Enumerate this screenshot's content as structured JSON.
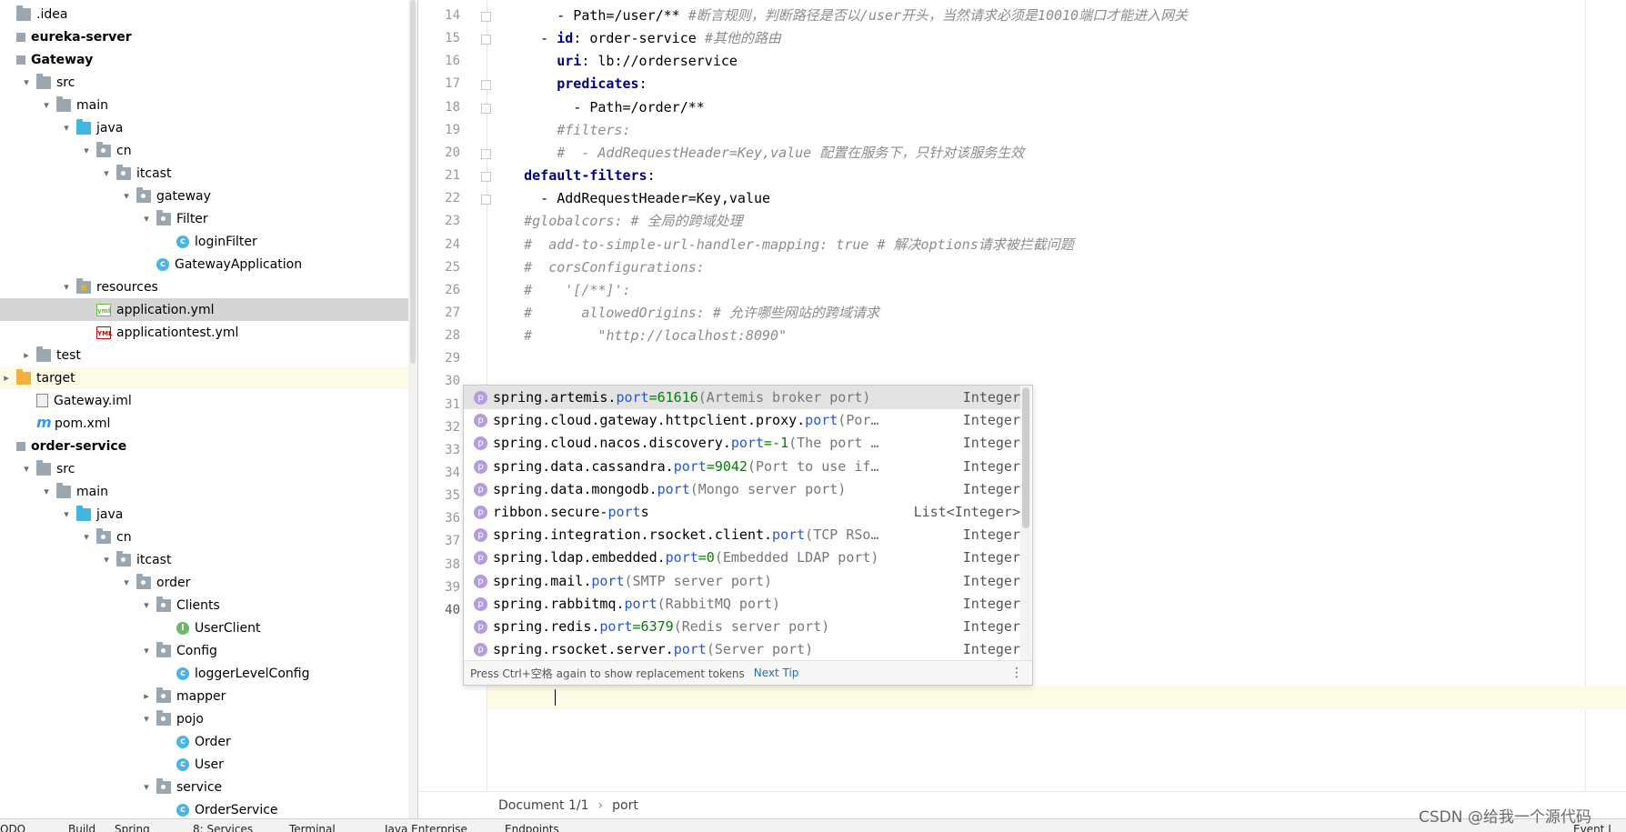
{
  "project_tree": {
    "items": [
      {
        "label": ".idea",
        "icon": "folder-icon",
        "arrow": "",
        "bold": false
      },
      {
        "label": "eureka-server",
        "icon": "module-icon",
        "arrow": "",
        "bold": true
      },
      {
        "label": "Gateway",
        "icon": "module-icon",
        "arrow": "",
        "bold": true
      },
      {
        "label": "src",
        "icon": "folder-icon",
        "arrow": "▾",
        "bold": false
      },
      {
        "label": "main",
        "icon": "folder-icon",
        "arrow": "▾",
        "bold": false
      },
      {
        "label": "java",
        "icon": "source-folder-icon",
        "arrow": "▾",
        "bold": false
      },
      {
        "label": "cn",
        "icon": "package-icon",
        "arrow": "▾",
        "bold": false
      },
      {
        "label": "itcast",
        "icon": "package-icon",
        "arrow": "▾",
        "bold": false
      },
      {
        "label": "gateway",
        "icon": "package-icon",
        "arrow": "▾",
        "bold": false
      },
      {
        "label": "Filter",
        "icon": "package-icon",
        "arrow": "▾",
        "bold": false
      },
      {
        "label": "loginFilter",
        "icon": "class-icon",
        "arrow": "",
        "bold": false
      },
      {
        "label": "GatewayApplication",
        "icon": "spring-boot-class-icon",
        "arrow": "",
        "bold": false
      },
      {
        "label": "resources",
        "icon": "resources-folder-icon",
        "arrow": "▾",
        "bold": false
      },
      {
        "label": "application.yml",
        "icon": "spring-yml-icon",
        "arrow": "",
        "bold": false
      },
      {
        "label": "applicationtest.yml",
        "icon": "yml-icon",
        "arrow": "",
        "bold": false
      },
      {
        "label": "test",
        "icon": "folder-icon",
        "arrow": "▸",
        "bold": false
      },
      {
        "label": "target",
        "icon": "excluded-folder-icon",
        "arrow": "▸",
        "bold": false
      },
      {
        "label": "Gateway.iml",
        "icon": "iml-file-icon",
        "arrow": "",
        "bold": false
      },
      {
        "label": "pom.xml",
        "icon": "maven-icon",
        "arrow": "",
        "bold": false
      },
      {
        "label": "order-service",
        "icon": "module-icon",
        "arrow": "",
        "bold": true
      },
      {
        "label": "src",
        "icon": "folder-icon",
        "arrow": "▾",
        "bold": false
      },
      {
        "label": "main",
        "icon": "folder-icon",
        "arrow": "▾",
        "bold": false
      },
      {
        "label": "java",
        "icon": "source-folder-icon",
        "arrow": "▾",
        "bold": false
      },
      {
        "label": "cn",
        "icon": "package-icon",
        "arrow": "▾",
        "bold": false
      },
      {
        "label": "itcast",
        "icon": "package-icon",
        "arrow": "▾",
        "bold": false
      },
      {
        "label": "order",
        "icon": "package-icon",
        "arrow": "▾",
        "bold": false
      },
      {
        "label": "Clients",
        "icon": "package-icon",
        "arrow": "▾",
        "bold": false
      },
      {
        "label": "UserClient",
        "icon": "interface-icon",
        "arrow": "",
        "bold": false
      },
      {
        "label": "Config",
        "icon": "package-icon",
        "arrow": "▾",
        "bold": false
      },
      {
        "label": "loggerLevelConfig",
        "icon": "class-icon",
        "arrow": "",
        "bold": false
      },
      {
        "label": "mapper",
        "icon": "package-icon",
        "arrow": "▸",
        "bold": false
      },
      {
        "label": "pojo",
        "icon": "package-icon",
        "arrow": "▾",
        "bold": false
      },
      {
        "label": "Order",
        "icon": "class-icon",
        "arrow": "",
        "bold": false
      },
      {
        "label": "User",
        "icon": "class-icon",
        "arrow": "",
        "bold": false
      },
      {
        "label": "service",
        "icon": "package-icon",
        "arrow": "▾",
        "bold": false
      },
      {
        "label": "OrderService",
        "icon": "class-icon",
        "arrow": "",
        "bold": false
      }
    ],
    "selected_label": "application.yml"
  },
  "editor": {
    "lines": [
      {
        "n": "14",
        "segments": [
          [
            "",
            "        - Path=/user/** "
          ],
          [
            "cm",
            "#断言规则，判断路径是否以/user开头，当然请求必须是10010端口才能进入网关"
          ]
        ]
      },
      {
        "n": "15",
        "segments": [
          [
            "",
            "      - "
          ],
          [
            "kw",
            "id"
          ],
          [
            "",
            ": order-service "
          ],
          [
            "cm",
            "#其他的路由"
          ]
        ]
      },
      {
        "n": "16",
        "segments": [
          [
            "",
            "        "
          ],
          [
            "kw",
            "uri"
          ],
          [
            "",
            ": lb://orderservice"
          ]
        ]
      },
      {
        "n": "17",
        "segments": [
          [
            "",
            "        "
          ],
          [
            "kw",
            "predicates"
          ],
          [
            "",
            ":"
          ]
        ]
      },
      {
        "n": "18",
        "segments": [
          [
            "",
            "          - Path=/order/**"
          ]
        ]
      },
      {
        "n": "19",
        "segments": [
          [
            "",
            "        "
          ],
          [
            "cm",
            "#filters:"
          ]
        ]
      },
      {
        "n": "20",
        "segments": [
          [
            "",
            "        "
          ],
          [
            "cm",
            "#  - AddRequestHeader=Key,value 配置在服务下，只针对该服务生效"
          ]
        ]
      },
      {
        "n": "21",
        "segments": [
          [
            "",
            "    "
          ],
          [
            "kw",
            "default-filters"
          ],
          [
            "",
            ":"
          ]
        ]
      },
      {
        "n": "22",
        "segments": [
          [
            "",
            "      - AddRequestHeader=Key,value"
          ]
        ]
      },
      {
        "n": "23",
        "segments": [
          [
            "",
            "    "
          ],
          [
            "cm",
            "#globalcors: # 全局的跨域处理"
          ]
        ]
      },
      {
        "n": "24",
        "segments": [
          [
            "",
            "    "
          ],
          [
            "cm",
            "#  add-to-simple-url-handler-mapping: true # 解决options请求被拦截问题"
          ]
        ]
      },
      {
        "n": "25",
        "segments": [
          [
            "",
            "    "
          ],
          [
            "cm",
            "#  corsConfigurations:"
          ]
        ]
      },
      {
        "n": "26",
        "segments": [
          [
            "",
            "    "
          ],
          [
            "cm",
            "#    '[/**]':"
          ]
        ]
      },
      {
        "n": "27",
        "segments": [
          [
            "",
            "    "
          ],
          [
            "cm",
            "#      allowedOrigins: # 允许哪些网站的跨域请求"
          ]
        ]
      },
      {
        "n": "28",
        "segments": [
          [
            "",
            "    "
          ],
          [
            "cm",
            "#        \"http://localhost:8090\""
          ]
        ]
      },
      {
        "n": "29",
        "segments": []
      },
      {
        "n": "30",
        "segments": []
      },
      {
        "n": "31",
        "segments": []
      },
      {
        "n": "32",
        "segments": []
      },
      {
        "n": "33",
        "segments": []
      },
      {
        "n": "34",
        "segments": []
      },
      {
        "n": "35",
        "segments": []
      },
      {
        "n": "36",
        "segments": []
      },
      {
        "n": "37",
        "segments": []
      },
      {
        "n": "38",
        "segments": []
      },
      {
        "n": "39",
        "segments": []
      },
      {
        "n": "40",
        "segments": [
          [
            "",
            "port"
          ]
        ]
      }
    ],
    "current_line": "40"
  },
  "completion_popup": {
    "items": [
      {
        "name": "spring.artemis.",
        "match": "port",
        "suffix": "",
        "value": "=61616",
        "desc": " (Artemis broker port)",
        "type": "Integer"
      },
      {
        "name": "spring.cloud.gateway.httpclient.proxy.",
        "match": "port",
        "suffix": "",
        "value": "",
        "desc": " (Por…",
        "type": "Integer"
      },
      {
        "name": "spring.cloud.nacos.discovery.",
        "match": "port",
        "suffix": "",
        "value": "=-1",
        "desc": " (The port …",
        "type": "Integer"
      },
      {
        "name": "spring.data.cassandra.",
        "match": "port",
        "suffix": "",
        "value": "=9042",
        "desc": " (Port to use if…",
        "type": "Integer"
      },
      {
        "name": "spring.data.mongodb.",
        "match": "port",
        "suffix": "",
        "value": "",
        "desc": " (Mongo server port)",
        "type": "Integer"
      },
      {
        "name": "ribbon.secure-",
        "match": "port",
        "suffix": "s",
        "value": "",
        "desc": "",
        "type": "List<Integer>"
      },
      {
        "name": "spring.integration.rsocket.client.",
        "match": "port",
        "suffix": "",
        "value": "",
        "desc": " (TCP RSo…",
        "type": "Integer"
      },
      {
        "name": "spring.ldap.embedded.",
        "match": "port",
        "suffix": "",
        "value": "=0",
        "desc": " (Embedded LDAP port)",
        "type": "Integer"
      },
      {
        "name": "spring.mail.",
        "match": "port",
        "suffix": "",
        "value": "",
        "desc": " (SMTP server port)",
        "type": "Integer"
      },
      {
        "name": "spring.rabbitmq.",
        "match": "port",
        "suffix": "",
        "value": "",
        "desc": " (RabbitMQ port)",
        "type": "Integer"
      },
      {
        "name": "spring.redis.",
        "match": "port",
        "suffix": "",
        "value": "=6379",
        "desc": " (Redis server port)",
        "type": "Integer"
      },
      {
        "name": "spring.rsocket.server.",
        "match": "port",
        "suffix": "",
        "value": "",
        "desc": " (Server port)",
        "type": "Integer"
      }
    ],
    "footer_tip": "Press Ctrl+空格 again to show replacement tokens",
    "footer_link": "Next Tip",
    "footer_menu": "⋮",
    "item_icon_letter": "p"
  },
  "breadcrumb": {
    "document": "Document 1/1",
    "separator": "›",
    "path": "port"
  },
  "status_bar": {
    "items": [
      "ODO",
      "Build",
      "Spring",
      "8: Services",
      "Terminal",
      "Java Enterprise",
      "Endpoints"
    ],
    "event_log": "Event L"
  },
  "watermark": "CSDN @给我一个源代码",
  "colors": {
    "keyword": "#000080",
    "comment": "#8c8c8c",
    "match": "#2257d6",
    "default_value": "#008000",
    "selected_row": "#d5d5d5",
    "current_line": "#fdfae6"
  }
}
